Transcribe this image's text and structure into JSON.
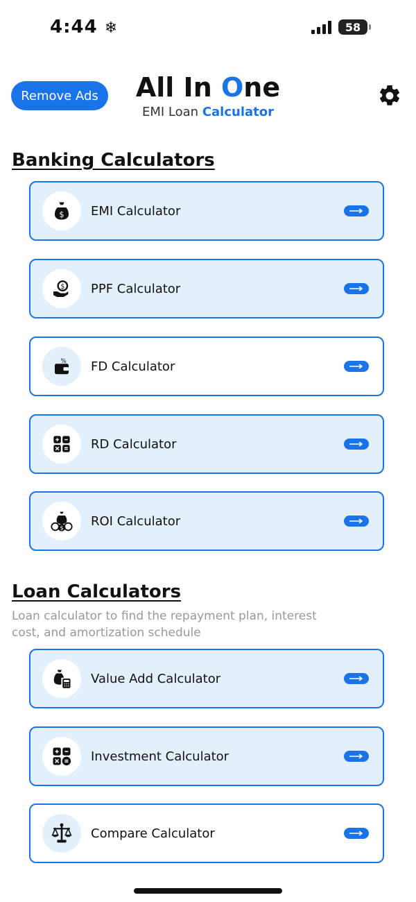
{
  "status": {
    "time": "4:44",
    "time_icon": "snowflake-icon",
    "battery": "58"
  },
  "header": {
    "remove_ads": "Remove Ads",
    "title_pre": "All In ",
    "title_accent": "O",
    "title_post": "ne",
    "subtitle_pre": "EMI Loan ",
    "subtitle_accent": "Calculator",
    "settings_icon": "gear-icon"
  },
  "banking": {
    "title": "Banking Calculators",
    "items": [
      {
        "label": "EMI Calculator",
        "icon": "money-bag-icon"
      },
      {
        "label": "PPF Calculator",
        "icon": "hand-coin-icon"
      },
      {
        "label": "FD Calculator",
        "icon": "wallet-percent-icon"
      },
      {
        "label": "RD Calculator",
        "icon": "calculator-grid-icon"
      },
      {
        "label": "ROI Calculator",
        "icon": "money-bags-icon"
      }
    ]
  },
  "loan": {
    "title": "Loan Calculators",
    "description": "Loan calculator to find the repayment plan, interest cost, and amortization schedule",
    "items": [
      {
        "label": "Value Add Calculator",
        "icon": "bag-calculator-icon"
      },
      {
        "label": "Investment Calculator",
        "icon": "calculator-equals-icon"
      },
      {
        "label": "Compare Calculator",
        "icon": "scale-icon"
      }
    ]
  },
  "colors": {
    "accent": "#1a73e8",
    "card_bg": "#e4effc",
    "muted_text": "#999999"
  }
}
